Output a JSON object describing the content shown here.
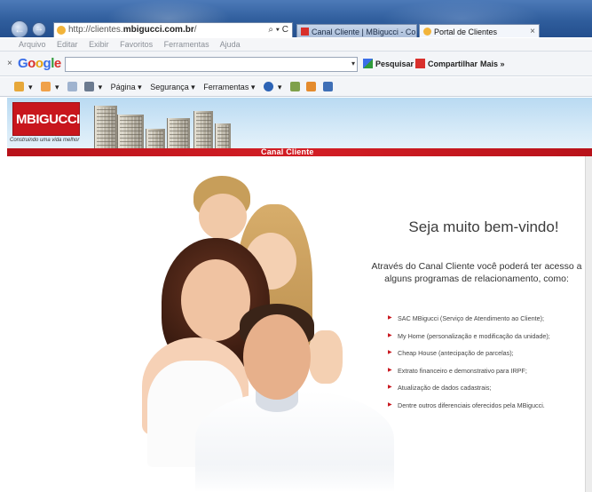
{
  "browser": {
    "address": {
      "prefix": "http://clientes.",
      "domain": "mbigucci.com.br",
      "suffix": "/"
    },
    "address_actions": "⌕ ▾ C",
    "back_glyph": "←",
    "forward_glyph": "→",
    "tabs": [
      {
        "label": "Canal Cliente | MBigucci - Con...",
        "active": false,
        "icon": "mbigucci-favicon"
      },
      {
        "label": "Portal de Clientes",
        "active": true,
        "icon": "ie-favicon"
      }
    ],
    "tab_close_glyph": "×",
    "menu": [
      "Arquivo",
      "Editar",
      "Exibir",
      "Favoritos",
      "Ferramentas",
      "Ajuda"
    ],
    "google_toolbar": {
      "close_glyph": "×",
      "logo": "Google",
      "search_value": "",
      "dropdown_glyph": "▾",
      "search_button": "Pesquisar ▾",
      "share_button": "Compartilhar",
      "more_button": "Mais »"
    },
    "command_bar": {
      "page": "Página ▾",
      "security": "Segurança ▾",
      "tools": "Ferramentas ▾"
    }
  },
  "site": {
    "logo": "MBIGUCCI",
    "tagline": "Construindo uma vida melhor",
    "section_bar": "Canal Cliente",
    "welcome": "Seja muito bem-vindo!",
    "intro": "Através do Canal Cliente você poderá ter acesso a alguns programas de relacionamento, como:",
    "bullets": [
      "SAC MBigucci (Serviço de Atendimento ao Cliente);",
      "My Home (personalização e modificação da unidade);",
      "Cheap House (antecipação de parcelas);",
      "Extrato financeiro e demonstrativo para IRPF;",
      "Atualização de dados cadastrais;",
      "Dentre outros diferenciais oferecidos pela MBigucci."
    ]
  },
  "colors": {
    "brand_red": "#c8161d",
    "header_sky": "#b9daf2",
    "title_bar": "#2f5d9c"
  }
}
